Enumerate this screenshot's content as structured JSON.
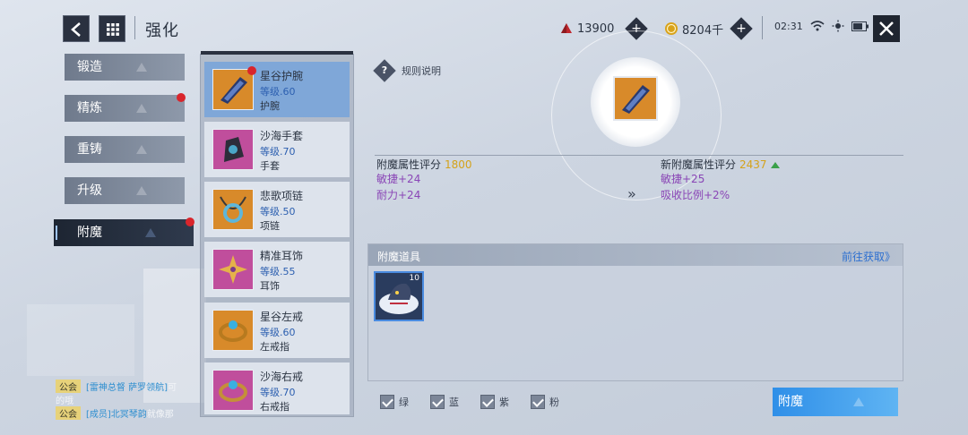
{
  "header": {
    "title": "强化"
  },
  "currencies": [
    {
      "name": "crystal",
      "value": "13900",
      "color": "#c0262c"
    },
    {
      "name": "gold",
      "value": "8204千",
      "color": "#d8a21a"
    }
  ],
  "status": {
    "time": "02:31"
  },
  "sidebar": {
    "items": [
      {
        "label": "锻造",
        "active": false,
        "red_dot": false
      },
      {
        "label": "精炼",
        "active": false,
        "red_dot": true
      },
      {
        "label": "重铸",
        "active": false,
        "red_dot": false
      },
      {
        "label": "升级",
        "active": false,
        "red_dot": false
      },
      {
        "label": "附魔",
        "active": true,
        "red_dot": true
      }
    ]
  },
  "equipment": [
    {
      "name": "星谷护腕",
      "level": "等级.60",
      "slot": "护腕",
      "selected": true,
      "red_dot": true,
      "bg": "#d88a2a"
    },
    {
      "name": "沙海手套",
      "level": "等级.70",
      "slot": "手套",
      "selected": false,
      "red_dot": false,
      "bg": "#c04e9c"
    },
    {
      "name": "悲歌项链",
      "level": "等级.50",
      "slot": "项链",
      "selected": false,
      "red_dot": false,
      "bg": "#d88a2a"
    },
    {
      "name": "精准耳饰",
      "level": "等级.55",
      "slot": "耳饰",
      "selected": false,
      "red_dot": false,
      "bg": "#c04e9c"
    },
    {
      "name": "星谷左戒",
      "level": "等级.60",
      "slot": "左戒指",
      "selected": false,
      "red_dot": false,
      "bg": "#d88a2a"
    },
    {
      "name": "沙海右戒",
      "level": "等级.70",
      "slot": "右戒指",
      "selected": false,
      "red_dot": false,
      "bg": "#c04e9c"
    }
  ],
  "rule_link": "规则说明",
  "current_attr": {
    "title": "附魔属性评分",
    "score": "1800",
    "lines": [
      "敏捷+24",
      "耐力+24"
    ]
  },
  "new_attr": {
    "title": "新附魔属性评分",
    "score": "2437",
    "lines": [
      "敏捷+25",
      "吸收比例+2%"
    ]
  },
  "props_panel": {
    "title": "附魔道具",
    "link": "前往获取》",
    "item_count": "10"
  },
  "filters": [
    {
      "label": "绿",
      "checked": true
    },
    {
      "label": "蓝",
      "checked": true
    },
    {
      "label": "紫",
      "checked": true
    },
    {
      "label": "粉",
      "checked": true
    }
  ],
  "enchant_button": "附魔",
  "chat": [
    {
      "tag": "公会",
      "link": "[雷神总督 萨罗领航]",
      "text": "可"
    },
    {
      "tag": "",
      "link": "",
      "text": "的哦"
    },
    {
      "tag": "公会",
      "link": "[成员]北冥琴韵",
      "text": "就像那"
    }
  ]
}
